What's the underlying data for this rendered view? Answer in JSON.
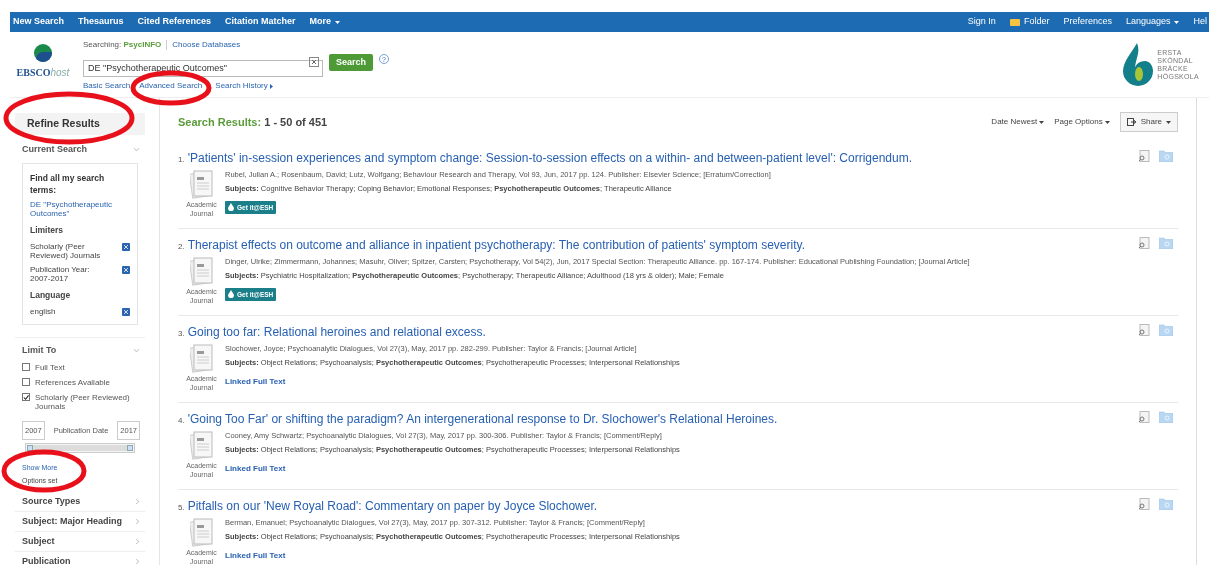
{
  "top_nav": {
    "left": [
      {
        "label": "New Search",
        "kind": "link"
      },
      {
        "label": "Thesaurus",
        "kind": "link"
      },
      {
        "label": "Cited References",
        "kind": "link"
      },
      {
        "label": "Citation Matcher",
        "kind": "link"
      },
      {
        "label": "More",
        "kind": "dropdown"
      }
    ],
    "right": [
      {
        "label": "Sign In",
        "kind": "link"
      },
      {
        "label": "Folder",
        "kind": "folder"
      },
      {
        "label": "Preferences",
        "kind": "link"
      },
      {
        "label": "Languages",
        "kind": "dropdown"
      },
      {
        "label": "Hel",
        "kind": "link"
      }
    ]
  },
  "header": {
    "logo_text": "EBSCO",
    "logo_suffix": "host",
    "searching_label": "Searching:",
    "database": "PsycINFO",
    "choose_databases": "Choose Databases",
    "search_value": "DE \"Psychotherapeutic Outcomes\"",
    "search_button": "Search",
    "help": "?",
    "links": [
      "Basic Search",
      "Advanced Search",
      "Search History"
    ],
    "institution": [
      "ERSTA",
      "SKÖNDAL",
      "BRÄCKE",
      "HÖGSKOLA"
    ]
  },
  "sidebar": {
    "title": "Refine Results",
    "current_search": {
      "heading": "Current Search",
      "find_all": "Find all my search terms:",
      "query": "DE \"Psychotherapeutic Outcomes\"",
      "groups": [
        {
          "heading": "Limiters",
          "items": [
            "Scholarly (Peer Reviewed) Journals",
            "Publication Year: 2007-2017"
          ]
        },
        {
          "heading": "Language",
          "items": [
            "english"
          ]
        }
      ]
    },
    "limit_to": {
      "heading": "Limit To",
      "options": [
        {
          "label": "Full Text",
          "checked": false
        },
        {
          "label": "References Available",
          "checked": false
        },
        {
          "label": "Scholarly (Peer Reviewed) Journals",
          "checked": true
        }
      ],
      "date_from": "2007",
      "date_label": "Publication Date",
      "date_to": "2017",
      "date_range": {
        "level": 1
      },
      "show_more": "Show More",
      "options_set": "Options set"
    },
    "facets": [
      "Source Types",
      "Subject: Major Heading",
      "Subject",
      "Publication"
    ]
  },
  "results": {
    "label": "Search Results:",
    "range": "1 - 50 of 451",
    "sort": "Date Newest",
    "page_options": "Page Options",
    "share": "Share",
    "items": [
      {
        "number": "1.",
        "title": "'Patients' in-session experiences and symptom change: Session-to-session effects on a within- and between-patient level': Corrigendum.",
        "meta": "Rubel, Julian A.; Rosenbaum, David; Lutz, Wolfgang; Behaviour Research and Therapy, Vol 93, Jun, 2017 pp. 124. Publisher: Elsevier Science; [Erratum/Correction]",
        "subjects_label": "Subjects:",
        "subjects": "Cognitive Behavior Therapy; Coping Behavior; Emotional Responses; **Psychotherapeutic Outcomes**; Therapeutic Alliance",
        "doc_type": "Academic Journal",
        "access": {
          "kind": "button",
          "label": "Get it@ESH"
        }
      },
      {
        "number": "2.",
        "title": "Therapist effects on outcome and alliance in inpatient psychotherapy: The contribution of patients' symptom severity.",
        "meta": "Dinger, Ulrike; Zimmermann, Johannes; Masuhr, Oliver; Spitzer, Carsten; Psychotherapy, Vol 54(2), Jun, 2017 Special Section: Therapeutic Alliance. pp. 167-174. Publisher: Educational Publishing Foundation; [Journal Article]",
        "subjects_label": "Subjects:",
        "subjects": "Psychiatric Hospitalization; **Psychotherapeutic Outcomes**; Psychotherapy; Therapeutic Alliance; Adulthood (18 yrs & older); Male; Female",
        "doc_type": "Academic Journal",
        "access": {
          "kind": "button",
          "label": "Get it@ESH"
        }
      },
      {
        "number": "3.",
        "title": "Going too far: Relational heroines and relational excess.",
        "meta": "Slochower, Joyce; Psychoanalytic Dialogues, Vol 27(3), May, 2017 pp. 282-299. Publisher: Taylor & Francis; [Journal Article]",
        "subjects_label": "Subjects:",
        "subjects": "Object Relations; Psychoanalysis; **Psychotherapeutic Outcomes**; Psychotherapeutic Processes; Interpersonal Relationships",
        "doc_type": "Academic Journal",
        "access": {
          "kind": "link",
          "label": "Linked Full Text"
        }
      },
      {
        "number": "4.",
        "title": "'Going Too Far' or shifting the paradigm? An intergenerational response to Dr. Slochower's Relational Heroines.",
        "meta": "Cooney, Amy Schwartz; Psychoanalytic Dialogues, Vol 27(3), May, 2017 pp. 300-306. Publisher: Taylor & Francis; [Comment/Reply]",
        "subjects_label": "Subjects:",
        "subjects": "Object Relations; Psychoanalysis; **Psychotherapeutic Outcomes**; Psychotherapeutic Processes; Interpersonal Relationships",
        "doc_type": "Academic Journal",
        "access": {
          "kind": "link",
          "label": "Linked Full Text"
        }
      },
      {
        "number": "5.",
        "title": "Pitfalls on our 'New Royal Road': Commentary on paper by Joyce Slochower.",
        "meta": "Berman, Emanuel; Psychoanalytic Dialogues, Vol 27(3), May, 2017 pp. 307-312. Publisher: Taylor & Francis; [Comment/Reply]",
        "subjects_label": "Subjects:",
        "subjects": "Object Relations; Psychoanalysis; **Psychotherapeutic Outcomes**; Psychotherapeutic Processes; Interpersonal Relationships",
        "doc_type": "Academic Journal",
        "access": {
          "kind": "link",
          "label": "Linked Full Text"
        }
      }
    ]
  }
}
